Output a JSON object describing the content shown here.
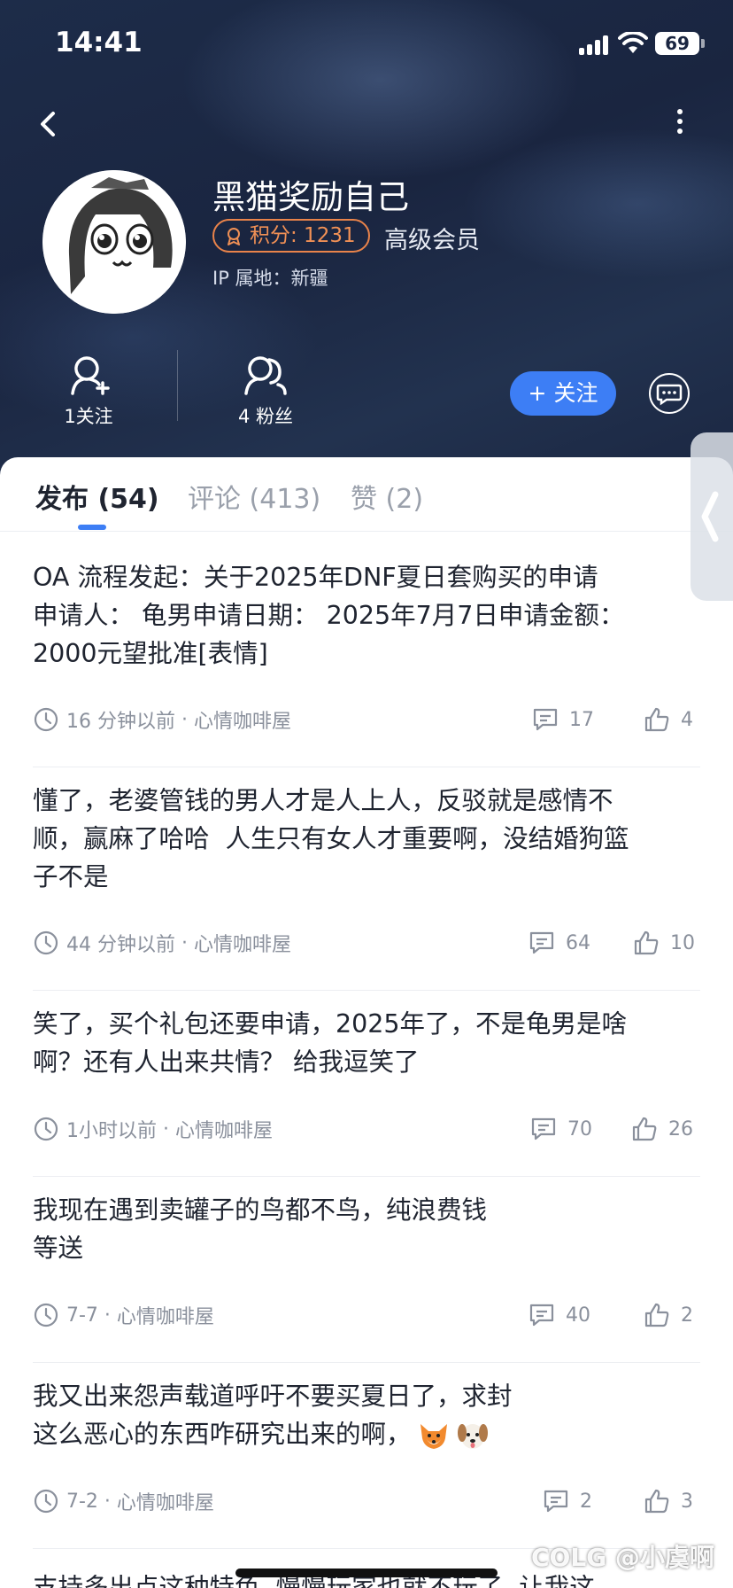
{
  "status": {
    "time": "14:41",
    "battery": "69"
  },
  "profile": {
    "username": "黑猫奖励自己",
    "points_label": "积分: 1231",
    "member_level": "高级会员",
    "ip_location": "IP 属地：新疆",
    "following": "1关注",
    "followers": "4 粉丝",
    "follow_button": "+ 关注"
  },
  "tabs": [
    {
      "label": "发布 (54)",
      "active": true
    },
    {
      "label": "评论 (413)",
      "active": false
    },
    {
      "label": "赞 (2)",
      "active": false
    }
  ],
  "posts": [
    {
      "text": "OA 流程发起：关于2025年DNF夏日套购买的申请\n申请人： 龟男申请日期： 2025年7月7日申请金额：\n2000元望批准[表情]",
      "time": "16 分钟以前",
      "board": "心情咖啡屋",
      "comments": "17",
      "likes": "4"
    },
    {
      "text": "懂了，老婆管钱的男人才是人上人，反驳就是感情不\n顺，赢麻了哈哈  人生只有女人才重要啊，没结婚狗篮\n子不是",
      "time": "44 分钟以前",
      "board": "心情咖啡屋",
      "comments": "64",
      "likes": "10"
    },
    {
      "text": "笑了，买个礼包还要申请，2025年了，不是龟男是啥\n啊？还有人出来共情？ 给我逗笑了",
      "time": "1小时以前",
      "board": "心情咖啡屋",
      "comments": "70",
      "likes": "26"
    },
    {
      "text": "我现在遇到卖罐子的鸟都不鸟，纯浪费钱\n等送",
      "time": "7-7",
      "board": "心情咖啡屋",
      "comments": "40",
      "likes": "2"
    },
    {
      "text": "我又出来怨声载道呼吁不要买夏日了，求封\n这么恶心的东西咋研究出来的啊，",
      "time": "7-2",
      "board": "心情咖啡屋",
      "comments": "2",
      "likes": "3"
    },
    {
      "text": "支持多出点这种特色  慢慢玩家也就不玩了  让我这",
      "time": "",
      "board": "",
      "comments": "",
      "likes": ""
    }
  ],
  "watermark": "COLG @小虞啊",
  "icons": {
    "back": "chevron-left-icon",
    "more": "more-vertical-icon",
    "points": "medal-icon",
    "following": "person-add-icon",
    "followers": "people-icon",
    "message": "chat-bubble-icon",
    "time": "clock-icon",
    "comments": "comment-icon",
    "likes": "thumbs-up-icon"
  },
  "colors": {
    "accent": "#3d7ef5",
    "points": "#f09055",
    "header_bg": "#1d2c49"
  }
}
